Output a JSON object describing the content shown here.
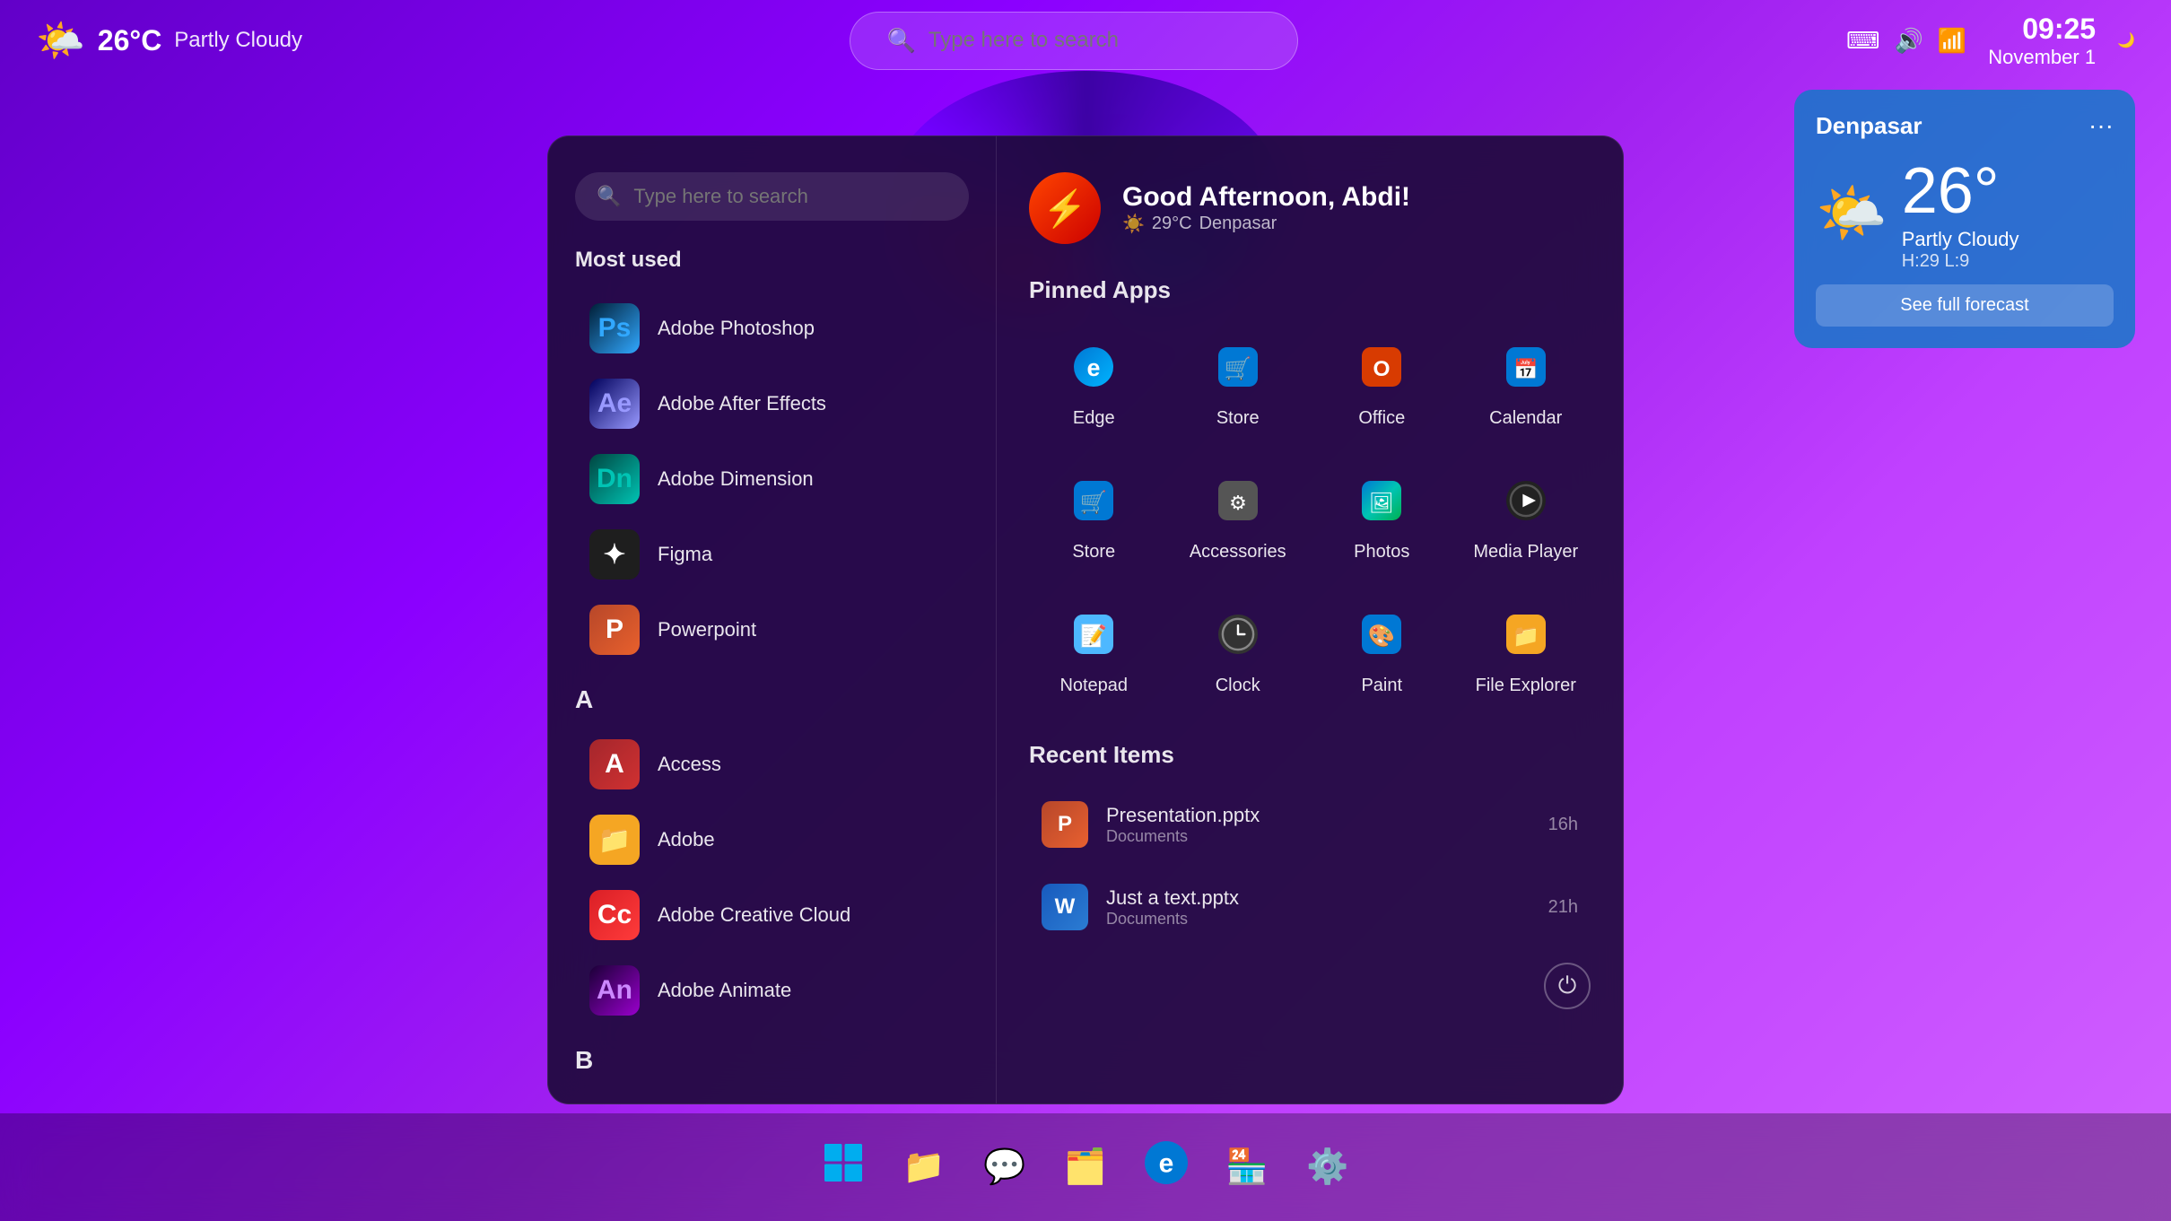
{
  "topbar": {
    "weather": {
      "temp": "26°C",
      "desc": "Partly Cloudy",
      "icon": "🌤️"
    },
    "search": {
      "placeholder": "Type here to search"
    },
    "time": "09:25",
    "date": "November 1",
    "moon_icon": "🌙"
  },
  "weather_card": {
    "city": "Denpasar",
    "temp": "26°",
    "desc": "Partly Cloudy",
    "detail": "H:29 L:9",
    "forecast_btn": "See full forecast",
    "icon": "🌤️",
    "dots": "···"
  },
  "start_menu": {
    "search": {
      "placeholder": "Type here to search"
    },
    "greeting": {
      "name": "Good Afternoon, Abdi!",
      "temp": "29°C",
      "location": "Denpasar"
    },
    "most_used_label": "Most used",
    "most_used": [
      {
        "name": "Adobe Photoshop",
        "icon": "Ps",
        "css_class": "ps-icon"
      },
      {
        "name": "Adobe After Effects",
        "icon": "Ae",
        "css_class": "ae-icon"
      },
      {
        "name": "Adobe Dimension",
        "icon": "Dn",
        "css_class": "dn-icon"
      },
      {
        "name": "Figma",
        "icon": "✦",
        "css_class": "figma-icon"
      },
      {
        "name": "Powerpoint",
        "icon": "P",
        "css_class": "ppt-icon"
      }
    ],
    "alpha_sections": [
      {
        "letter": "A",
        "apps": [
          {
            "name": "Access",
            "icon": "A",
            "css_class": "access-icon"
          },
          {
            "name": "Adobe",
            "icon": "📁",
            "css_class": "adobe-folder-icon"
          },
          {
            "name": "Adobe Creative Cloud",
            "icon": "Cc",
            "css_class": "adobecc-icon"
          },
          {
            "name": "Adobe Animate",
            "icon": "An",
            "css_class": "an-icon"
          }
        ]
      },
      {
        "letter": "B",
        "apps": []
      }
    ],
    "pinned_section_label": "Pinned Apps",
    "pinned_apps": [
      {
        "name": "Edge",
        "icon": "🌐",
        "css_class": "edge-icon"
      },
      {
        "name": "Store",
        "icon": "🏪",
        "css_class": "store-icon"
      },
      {
        "name": "Office",
        "icon": "🅾️",
        "css_class": "office-icon"
      },
      {
        "name": "Calendar",
        "icon": "📅",
        "css_class": "calendar-icon"
      },
      {
        "name": "Store",
        "icon": "🏪",
        "css_class": "store2-icon"
      },
      {
        "name": "Accessories",
        "icon": "⚙️",
        "css_class": "accessories-icon"
      },
      {
        "name": "Photos",
        "icon": "🖼️",
        "css_class": "photos-icon"
      },
      {
        "name": "Media Player",
        "icon": "▶",
        "css_class": "mediaplayer-icon"
      },
      {
        "name": "Notepad",
        "icon": "📝",
        "css_class": "notepad-icon"
      },
      {
        "name": "Clock",
        "icon": "🕐",
        "css_class": "clock-icon"
      },
      {
        "name": "Paint",
        "icon": "🎨",
        "css_class": "paint-icon"
      },
      {
        "name": "File Explorer",
        "icon": "📁",
        "css_class": "fileexp-icon"
      }
    ],
    "recent_section_label": "Recent Items",
    "recent_items": [
      {
        "name": "Presentation.pptx",
        "location": "Documents",
        "time": "16h",
        "icon": "P",
        "css_class": "pptx-icon"
      },
      {
        "name": "Just a text.pptx",
        "location": "Documents",
        "time": "21h",
        "icon": "W",
        "css_class": "word-icon"
      }
    ],
    "power_icon": "⏻"
  },
  "taskbar": {
    "icons": [
      {
        "name": "windows-start",
        "icon": "⊞"
      },
      {
        "name": "file-explorer",
        "icon": "📁"
      },
      {
        "name": "chat",
        "icon": "💬"
      },
      {
        "name": "folder",
        "icon": "🗂️"
      },
      {
        "name": "edge",
        "icon": "🌐"
      },
      {
        "name": "store",
        "icon": "🏪"
      },
      {
        "name": "settings",
        "icon": "⚙️"
      }
    ]
  }
}
